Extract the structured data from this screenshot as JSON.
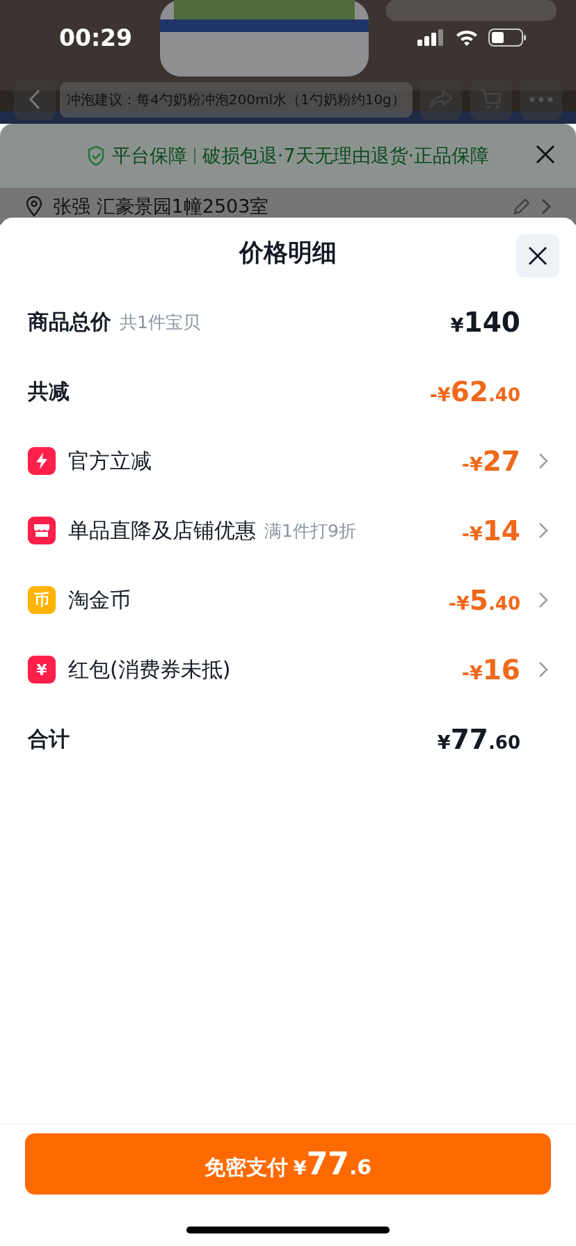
{
  "status_bar": {
    "time": "00:29"
  },
  "product_header": {
    "title": "冲泡建议：每4勺奶粉冲泡200ml水（1勺奶粉约10g）"
  },
  "guarantee": {
    "label": "平台保障",
    "text": "破损包退·7天无理由退货·正品保障"
  },
  "address": {
    "text": "张强 汇豪景园1幢2503室"
  },
  "sheet": {
    "title": "价格明细",
    "rows": [
      {
        "kind": "total",
        "label": "商品总价",
        "note": "共1件宝贝",
        "price": {
          "currency": "¥",
          "amount": "140"
        },
        "highlighted": false
      },
      {
        "kind": "total",
        "label": "共减",
        "price": {
          "currency": "-¥",
          "amount": "62",
          "cents": ".40"
        },
        "highlighted": true
      },
      {
        "kind": "discount",
        "label": "官方立减",
        "color": "#ff1f4b",
        "price": {
          "currency": "-¥",
          "amount": "27"
        },
        "highlighted": true
      },
      {
        "kind": "discount",
        "label": "单品直降及店铺优惠",
        "note": "满1件打9折",
        "color": "#ff1f4b",
        "price": {
          "currency": "-¥",
          "amount": "14"
        },
        "highlighted": true
      },
      {
        "kind": "discount",
        "label": "淘金币",
        "color": "#ffb400",
        "badge_text": "币",
        "price": {
          "currency": "-¥",
          "amount": "5",
          "cents": ".40"
        },
        "highlighted": true
      },
      {
        "kind": "discount",
        "label": "红包(消费券未抵)",
        "color": "#ff1f4b",
        "badge_text": "¥",
        "price": {
          "currency": "-¥",
          "amount": "16"
        },
        "highlighted": true
      },
      {
        "kind": "total",
        "label": "合计",
        "price": {
          "currency": "¥",
          "amount": "77",
          "cents": ".60"
        },
        "highlighted": false
      }
    ]
  },
  "pay_button": {
    "label": "免密支付",
    "currency": "¥",
    "amount": "77",
    "cents": ".6"
  }
}
